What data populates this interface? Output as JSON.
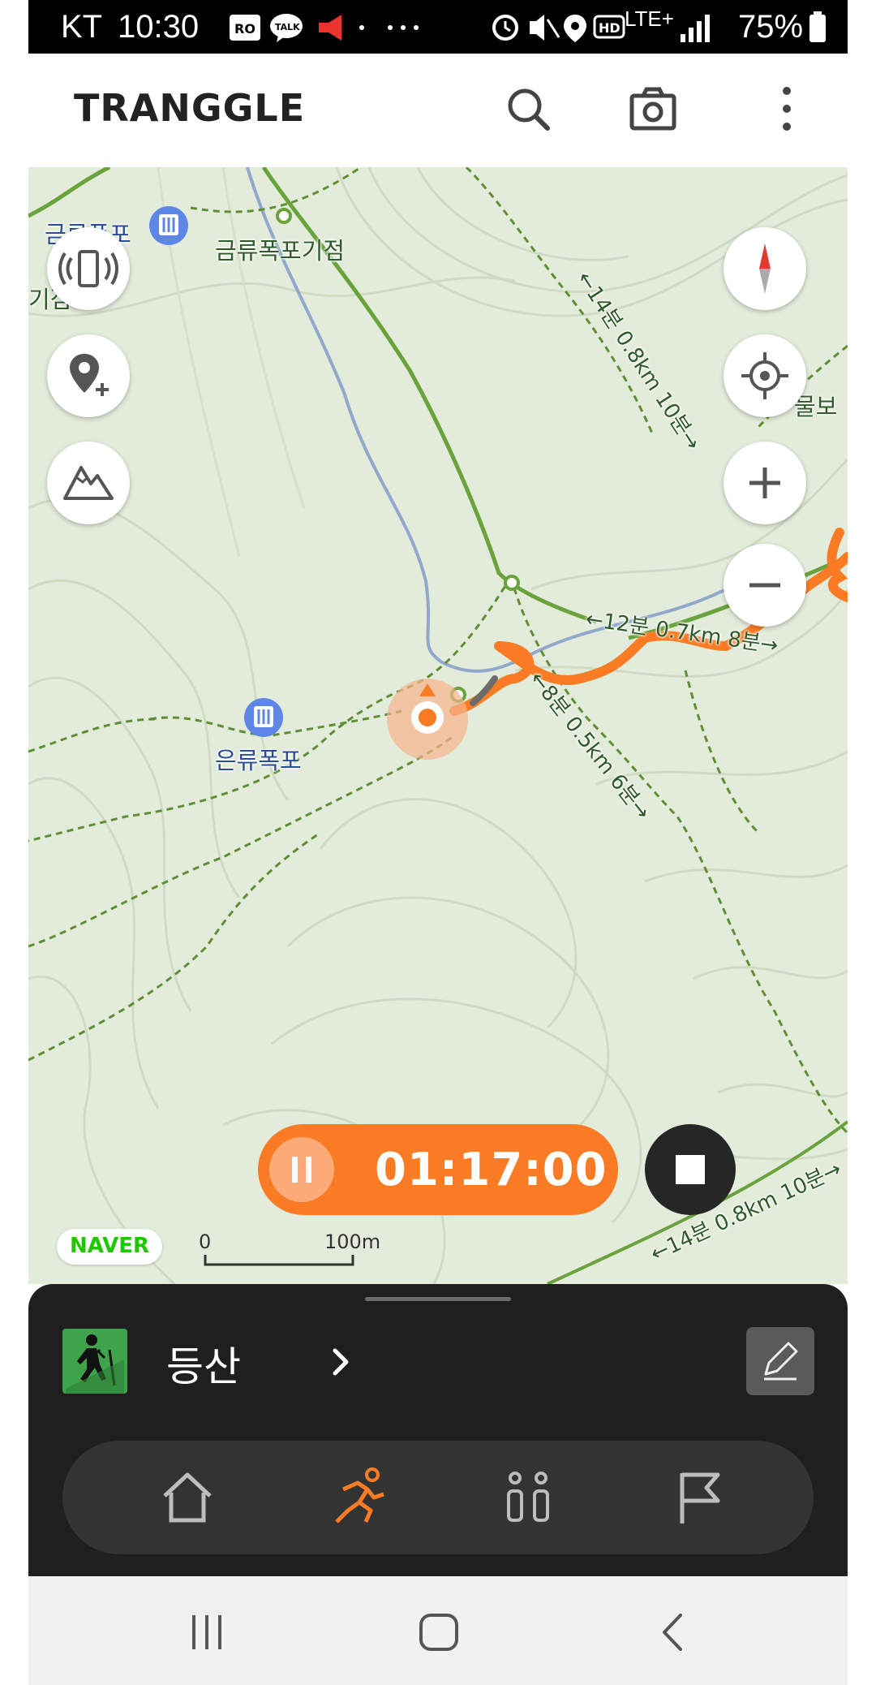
{
  "status_bar": {
    "carrier": "KT",
    "time": "10:30",
    "network": "LTE+",
    "battery": "75%"
  },
  "header": {
    "logo": "TRANGGLE",
    "icons": [
      "search-icon",
      "camera-icon",
      "more-vertical-icon"
    ]
  },
  "map": {
    "labels": {
      "waterfall_top": "금류폭포",
      "junction_top": "금류폭포기점",
      "edge_left": "기점",
      "edge_right": "물보",
      "waterfall_mid": "은류폭포",
      "trail_top_right": "←14분 0.8km 10분→",
      "trail_mid_right": "←12분 0.7km 8분→",
      "trail_center": "←8분 0.5km 6분→",
      "trail_bottom_right": "←14분 0.8km 10분→"
    },
    "scale": {
      "start": "0",
      "end": "100m"
    },
    "attribution": "NAVER",
    "left_controls": [
      "vibration-icon",
      "add-location-icon",
      "mountain-icon"
    ],
    "right_controls": [
      "compass-icon",
      "locate-icon",
      "zoom-in-icon",
      "zoom-out-icon"
    ],
    "colors": {
      "track": "#f97c25",
      "trail": "#6aa23c",
      "stream": "#8fa8cc"
    }
  },
  "recorder": {
    "elapsed": "01:17:00",
    "accent": "#f97c25"
  },
  "activity": {
    "label": "등산",
    "icon": "hiker-icon"
  },
  "tabs": [
    {
      "icon": "home-icon",
      "active": false
    },
    {
      "icon": "running-icon",
      "active": true
    },
    {
      "icon": "people-icon",
      "active": false
    },
    {
      "icon": "flag-icon",
      "active": false
    }
  ],
  "system_nav": [
    "recent-apps-icon",
    "home-button-icon",
    "back-icon"
  ]
}
